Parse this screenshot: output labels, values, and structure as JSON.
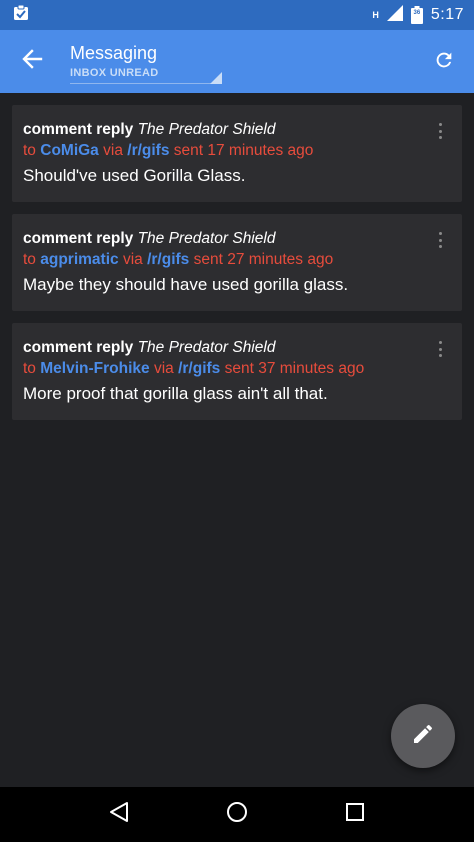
{
  "status_bar": {
    "network_label": "H",
    "battery_level": "36",
    "time": "5:17"
  },
  "header": {
    "title": "Messaging",
    "subtitle": "INBOX UNREAD"
  },
  "messages": [
    {
      "kind": "comment reply",
      "thread": "The Predator Shield",
      "to_label": "to",
      "author": "CoMiGa",
      "via_label": "via",
      "subreddit": "/r/gifs",
      "sent": "sent 17 minutes ago",
      "body": "Should've used Gorilla Glass."
    },
    {
      "kind": "comment reply",
      "thread": "The Predator Shield",
      "to_label": "to",
      "author": "agprimatic",
      "via_label": "via",
      "subreddit": "/r/gifs",
      "sent": "sent 27 minutes ago",
      "body": "Maybe they should have used gorilla glass."
    },
    {
      "kind": "comment reply",
      "thread": "The Predator Shield",
      "to_label": "to",
      "author": "Melvin-Frohike",
      "via_label": "via",
      "subreddit": "/r/gifs",
      "sent": "sent 37 minutes ago",
      "body": "More proof that gorilla glass ain't all that."
    }
  ],
  "icons": {
    "back": "arrow-back-icon",
    "refresh": "refresh-icon",
    "more": "more-vert-icon",
    "compose": "pencil-icon",
    "nav_back": "triangle-back-icon",
    "nav_home": "circle-home-icon",
    "nav_recents": "square-recents-icon"
  },
  "colors": {
    "app_bar": "#4b8ce9",
    "status_bar": "#2e6bbf",
    "background": "#1f2023",
    "card": "#2d2d30",
    "author_link": "#4b8ce9",
    "meta_text": "#e74c3c"
  }
}
